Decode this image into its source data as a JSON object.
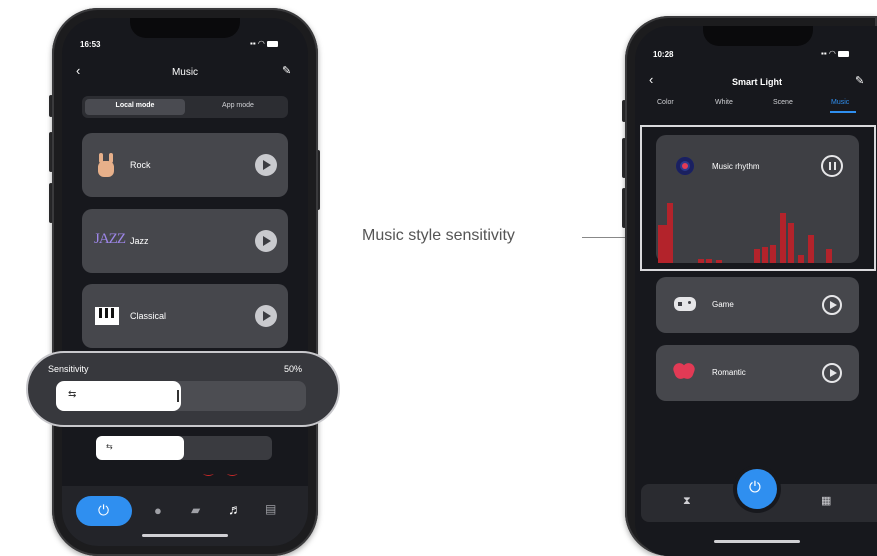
{
  "left_phone": {
    "time": "16:53",
    "header_title": "Music",
    "tabs": [
      "Local mode",
      "App mode"
    ],
    "styles": [
      {
        "label": "Rock",
        "icon": "rock-hand-icon"
      },
      {
        "label": "Jazz",
        "icon": "jazz-text-icon",
        "icon_text": "JAZZ"
      },
      {
        "label": "Classical",
        "icon": "piano-icon"
      }
    ],
    "sensitivity_label": "Sensitivity",
    "sensitivity_value": "50%",
    "sensitivity_level": 0.5,
    "nav_icons": [
      "power-icon",
      "bulb-icon",
      "scene-icon",
      "music-icon",
      "settings-icon"
    ]
  },
  "callout_label": "Music style sensitivity",
  "right_phone": {
    "time": "10:28",
    "header_title": "Smart Light",
    "tabs": [
      "Color",
      "White",
      "Scene",
      "Music"
    ],
    "active_tab": "Music",
    "items": [
      {
        "label": "Music rhythm",
        "icon": "music-disc-icon",
        "state": "pause"
      },
      {
        "label": "Game",
        "icon": "gamepad-icon",
        "state": "play"
      },
      {
        "label": "Romantic",
        "icon": "heart-icon",
        "state": "play"
      }
    ],
    "nav_icons": [
      "timer-icon",
      "power-icon",
      "grid-icon"
    ]
  },
  "colors": {
    "accent_blue": "#2f8ff0",
    "spectrum_red": "#b3232b"
  }
}
